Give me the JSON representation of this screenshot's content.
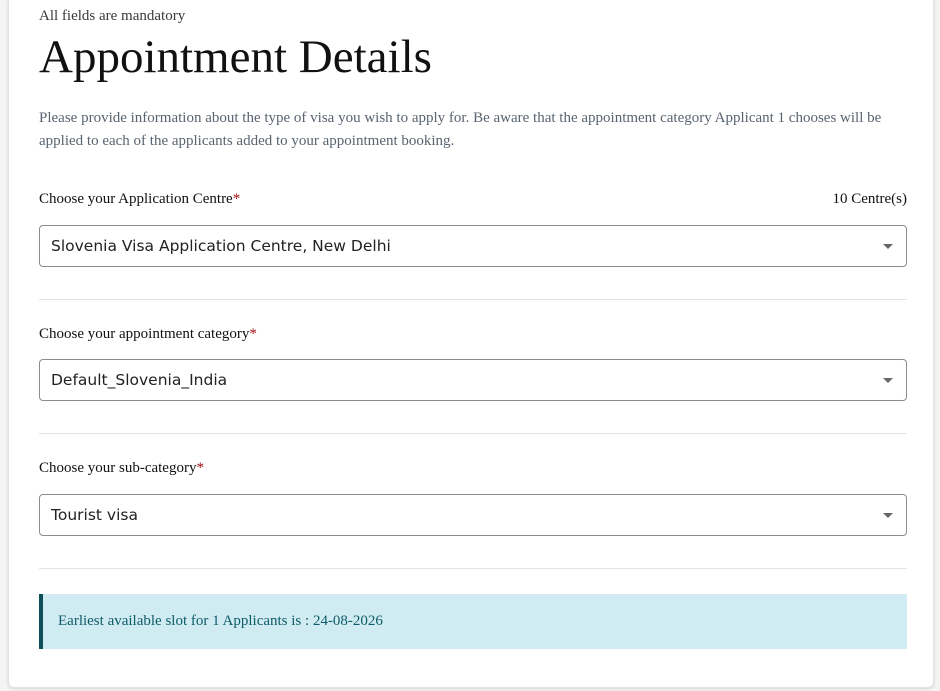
{
  "form": {
    "mandatory_note": "All fields are mandatory",
    "title": "Appointment Details",
    "description": "Please provide information about the type of visa you wish to apply for. Be aware that the appointment category Applicant 1 chooses will be applied to each of the applicants added to your appointment booking.",
    "required_marker": "*",
    "centre": {
      "label": "Choose your Application Centre",
      "count_text": "10 Centre(s)",
      "selected": "Slovenia Visa Application Centre, New Delhi"
    },
    "category": {
      "label": "Choose your appointment category",
      "selected": "Default_Slovenia_India"
    },
    "subcategory": {
      "label": "Choose your sub-category",
      "selected": "Tourist visa"
    },
    "slot_alert": "Earliest available slot for 1 Applicants is : 24-08-2026"
  },
  "colors": {
    "required": "#9e0b0f",
    "alert_bg": "#d0ebf1",
    "alert_border": "#0c4f5a",
    "alert_text": "#0d5c6a"
  },
  "icons": {
    "dropdown": "chevron-down-icon"
  }
}
